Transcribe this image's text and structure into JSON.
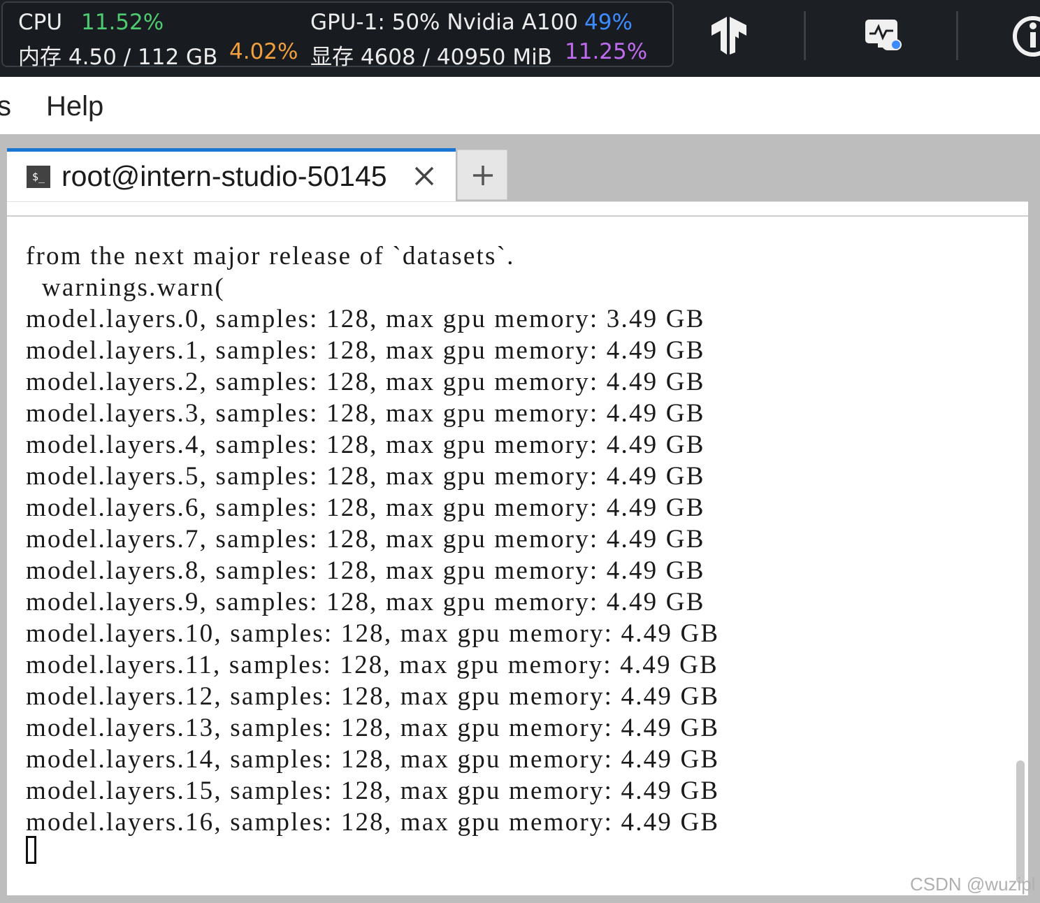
{
  "monitor": {
    "cpu_label": "CPU",
    "cpu_value": "11.52%",
    "gpu_label": "GPU-1: 50% Nvidia A100",
    "gpu_value": "49%",
    "mem_label": "内存 4.50 / 112 GB",
    "mem_value": "4.02%",
    "vram_label": "显存 4608 / 40950 MiB",
    "vram_value": "11.25%",
    "colors": {
      "cpu": "#4ecb71",
      "gpu": "#3d8cff",
      "mem": "#f2a03d",
      "vram": "#c06cf0"
    }
  },
  "topbar_icons": [
    "tensorflow-icon",
    "monitor-settings-icon",
    "info-icon"
  ],
  "menubar": {
    "cut_item": "s",
    "help": "Help"
  },
  "tabs": {
    "active_title": "root@intern-studio-50145",
    "terminal_icon_text": "$_",
    "add_label": "+"
  },
  "terminal": {
    "lines": [
      "from the next major release of `datasets`.",
      "  warnings.warn(",
      "model.layers.0, samples: 128, max gpu memory: 3.49 GB",
      "model.layers.1, samples: 128, max gpu memory: 4.49 GB",
      "model.layers.2, samples: 128, max gpu memory: 4.49 GB",
      "model.layers.3, samples: 128, max gpu memory: 4.49 GB",
      "model.layers.4, samples: 128, max gpu memory: 4.49 GB",
      "model.layers.5, samples: 128, max gpu memory: 4.49 GB",
      "model.layers.6, samples: 128, max gpu memory: 4.49 GB",
      "model.layers.7, samples: 128, max gpu memory: 4.49 GB",
      "model.layers.8, samples: 128, max gpu memory: 4.49 GB",
      "model.layers.9, samples: 128, max gpu memory: 4.49 GB",
      "model.layers.10, samples: 128, max gpu memory: 4.49 GB",
      "model.layers.11, samples: 128, max gpu memory: 4.49 GB",
      "model.layers.12, samples: 128, max gpu memory: 4.49 GB",
      "model.layers.13, samples: 128, max gpu memory: 4.49 GB",
      "model.layers.14, samples: 128, max gpu memory: 4.49 GB",
      "model.layers.15, samples: 128, max gpu memory: 4.49 GB",
      "model.layers.16, samples: 128, max gpu memory: 4.49 GB"
    ]
  },
  "watermark": "CSDN @wuzipl"
}
